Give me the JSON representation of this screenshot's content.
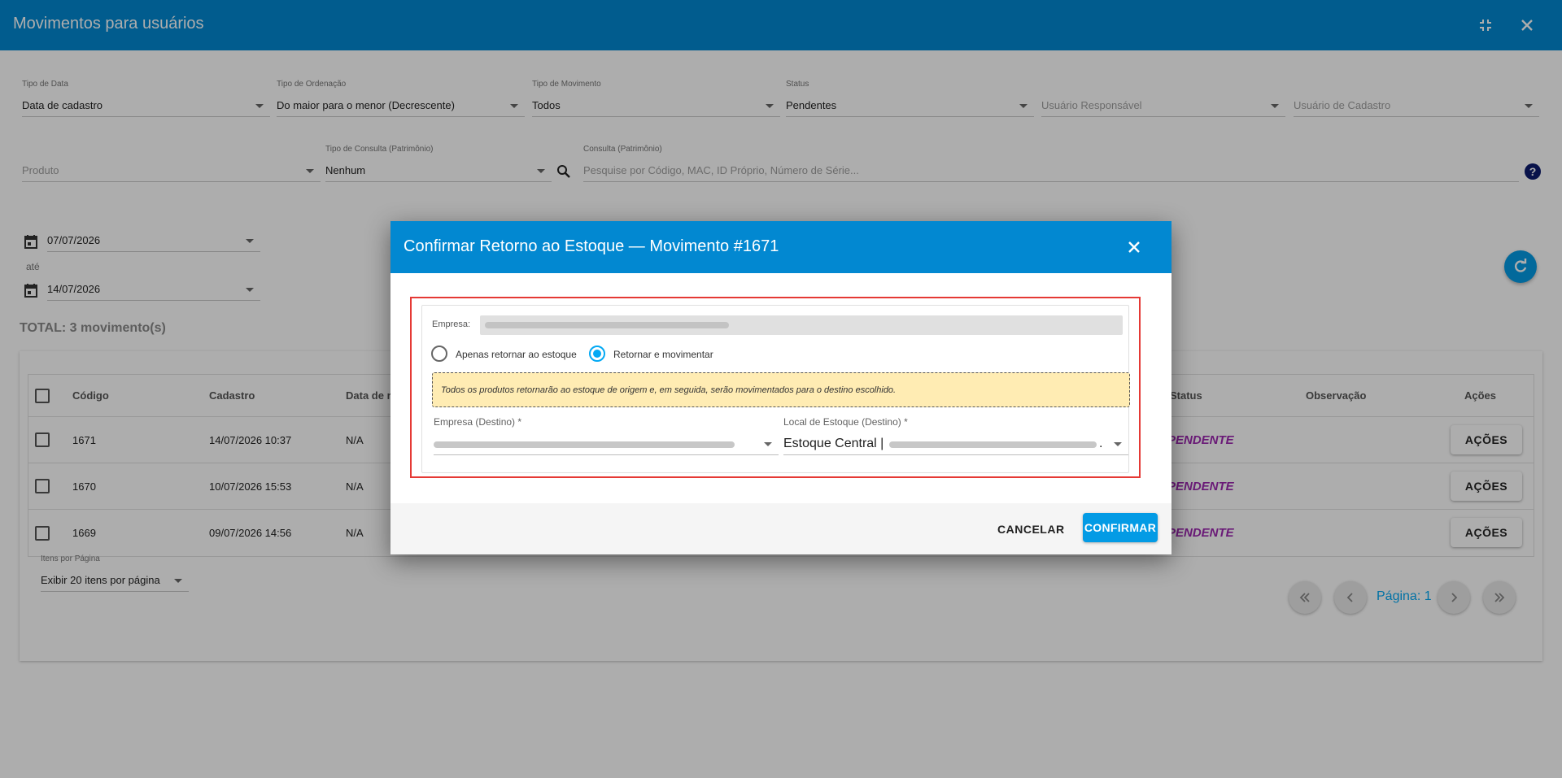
{
  "window": {
    "title": "Movimentos para usuários"
  },
  "filters": {
    "tipo_data": {
      "label": "Tipo de Data",
      "value": "Data de cadastro"
    },
    "tipo_ordenacao": {
      "label": "Tipo de Ordenação",
      "value": "Do maior para o menor (Decrescente)"
    },
    "tipo_movimento": {
      "label": "Tipo de Movimento",
      "value": "Todos"
    },
    "status": {
      "label": "Status",
      "value": "Pendentes"
    },
    "usuario_responsavel": {
      "placeholder": "Usuário Responsável"
    },
    "usuario_cadastro": {
      "placeholder": "Usuário de Cadastro"
    },
    "produto": {
      "placeholder": "Produto"
    },
    "tipo_consulta": {
      "label": "Tipo de Consulta (Patrimônio)",
      "value": "Nenhum"
    },
    "consulta": {
      "label": "Consulta (Patrimônio)",
      "placeholder": "Pesquise por Código, MAC, ID Próprio, Número de Série..."
    },
    "date_from": "07/07/2026",
    "date_sep": "até",
    "date_to": "14/07/2026"
  },
  "total": "TOTAL: 3 movimento(s)",
  "table": {
    "headers": {
      "codigo": "Código",
      "cadastro": "Cadastro",
      "data_ret": "Data de r",
      "status": "Status",
      "observacao": "Observação",
      "acoes": "Ações"
    },
    "rows": [
      {
        "codigo": "1671",
        "cadastro": "14/07/2026 10:37",
        "data": "N/A",
        "status": "PENDENTE",
        "acoes": "AÇÕES"
      },
      {
        "codigo": "1670",
        "cadastro": "10/07/2026 15:53",
        "data": "N/A",
        "status": "PENDENTE",
        "acoes": "AÇÕES"
      },
      {
        "codigo": "1669",
        "cadastro": "09/07/2026 14:56",
        "data": "N/A",
        "status": "PENDENTE",
        "acoes": "AÇÕES"
      }
    ]
  },
  "pagination": {
    "per_page_label": "Itens por Página",
    "per_page_value": "Exibir 20 itens por página",
    "page_label": "Página: 1"
  },
  "modal": {
    "title": "Confirmar Retorno ao Estoque — Movimento #1671",
    "empresa_label": "Empresa:",
    "option_1": "Apenas retornar ao estoque",
    "option_2": "Retornar e movimentar",
    "selected_option": "Retornar e movimentar",
    "warning": "Todos os produtos retornarão ao estoque de origem e, em seguida, serão movimentados para o destino escolhido.",
    "empresa_destino_label": "Empresa (Destino) *",
    "local_destino_label": "Local de Estoque (Destino) *",
    "local_destino_value": "Estoque Central |",
    "local_destino_suffix": ".",
    "cancel": "CANCELAR",
    "confirm": "CONFIRMAR"
  },
  "colors": {
    "primary": "#0288d1",
    "accent": "#039be5",
    "pending": "#9c27b0",
    "warning_bg": "#ffecb3",
    "highlight": "#e53935"
  },
  "icons": [
    "collapse-icon",
    "close-icon",
    "search-icon",
    "help-icon",
    "calendar-icon",
    "refresh-icon",
    "first-page-icon",
    "prev-page-icon",
    "next-page-icon",
    "last-page-icon"
  ]
}
